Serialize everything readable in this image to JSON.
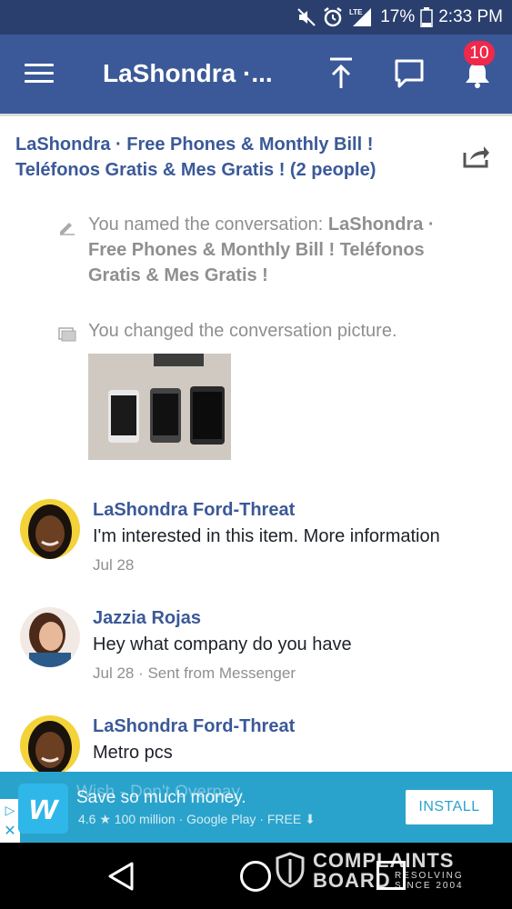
{
  "status_bar": {
    "battery_pct": "17%",
    "time": "2:33 PM",
    "network": "LTE",
    "icons": [
      "mute-icon",
      "alarm-icon",
      "signal-icon",
      "battery-icon"
    ]
  },
  "app_bar": {
    "title": "LaShondra ·...",
    "notification_count": "10",
    "icons": [
      "menu-icon",
      "scroll-top-icon",
      "chat-icon",
      "bell-icon"
    ]
  },
  "conversation": {
    "title": "LaShondra · Free Phones & Monthly Bill ! Teléfonos Gratis & Mes Gratis ! (2 people)"
  },
  "events": {
    "renamed_prefix": "You named the conversation: ",
    "renamed_name": "LaShondra · Free Phones & Monthly Bill ! Teléfonos Gratis & Mes Gratis !",
    "picture_changed": "You changed the conversation picture."
  },
  "messages": [
    {
      "sender": "LaShondra Ford-Threat",
      "text": "I'm interested in this item. More information",
      "meta": "Jul 28"
    },
    {
      "sender": "Jazzia Rojas",
      "text": "Hey what company do you have",
      "meta": "Jul 28 · Sent from Messenger"
    },
    {
      "sender": "LaShondra Ford-Threat",
      "text": "Metro pcs",
      "meta": ""
    }
  ],
  "ad": {
    "logo_letter": "w",
    "ghost_title": "Wish - Don't Overpay",
    "title": "Save so much money.",
    "sub": "4.6 ★ 100 million · Google Play · FREE ⬇",
    "install_label": "INSTALL",
    "choices_glyph": "▷",
    "close_glyph": "✕"
  },
  "watermark": {
    "line1": "COMPLAINTS",
    "line2": "BOARD",
    "sub1": "RESOLVING",
    "sub2": "SINCE 2004"
  },
  "colors": {
    "brand": "#3b5998",
    "status_bar": "#2b3f6e",
    "badge": "#f02849",
    "ad_bg": "#2aa3cc"
  }
}
